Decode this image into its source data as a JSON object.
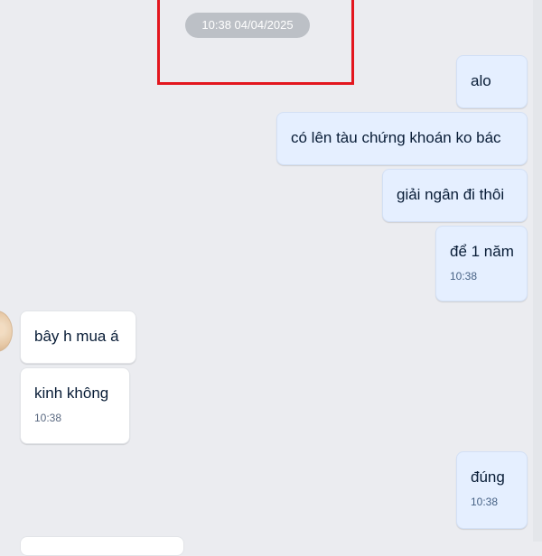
{
  "chat": {
    "divider_timestamp": "10:38 04/04/2025",
    "messages": [
      {
        "direction": "sent",
        "text": "alo",
        "time": ""
      },
      {
        "direction": "sent",
        "text": "có lên tàu chứng khoán ko bác",
        "time": ""
      },
      {
        "direction": "sent",
        "text": "giải ngân đi thôi",
        "time": ""
      },
      {
        "direction": "sent",
        "text": "để 1 năm",
        "time": "10:38"
      },
      {
        "direction": "received",
        "text": "bây h mua á",
        "time": ""
      },
      {
        "direction": "received",
        "text": "kinh không",
        "time": "10:38"
      },
      {
        "direction": "sent",
        "text": "đúng",
        "time": "10:38"
      }
    ]
  },
  "colors": {
    "background": "#ebecf0",
    "sent_bubble": "#e5efff",
    "received_bubble": "#ffffff",
    "timestamp_pill": "#bcc0c6",
    "highlight": "#e3161e"
  }
}
